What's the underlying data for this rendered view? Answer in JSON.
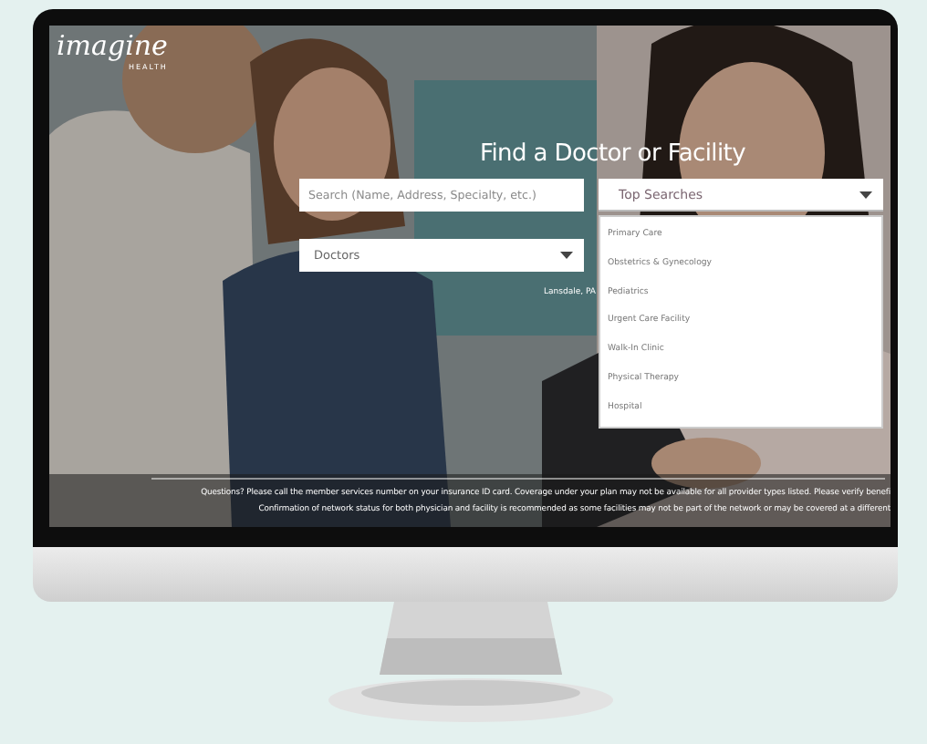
{
  "logo": {
    "name": "imagine",
    "tagline": "HEALTH"
  },
  "title": "Find a Doctor or Facility",
  "search": {
    "placeholder": "Search (Name, Address, Specialty, etc.)"
  },
  "top_searches": {
    "label": "Top Searches",
    "expanded": true,
    "options": [
      "Primary Care",
      "Obstetrics & Gynecology",
      "Pediatrics",
      "Urgent Care Facility",
      "Walk-In Clinic",
      "Physical Therapy",
      "Hospital"
    ]
  },
  "provider_type": {
    "value": "Doctors"
  },
  "location": "Lansdale, PA",
  "footer": [
    "Questions? Please call the member services number on your insurance ID card. Coverage under your plan may not be available for all provider types listed. Please verify benefi",
    "Confirmation of network status for both physician and facility is recommended as some facilities may not be part of the network or may be covered at a different"
  ]
}
